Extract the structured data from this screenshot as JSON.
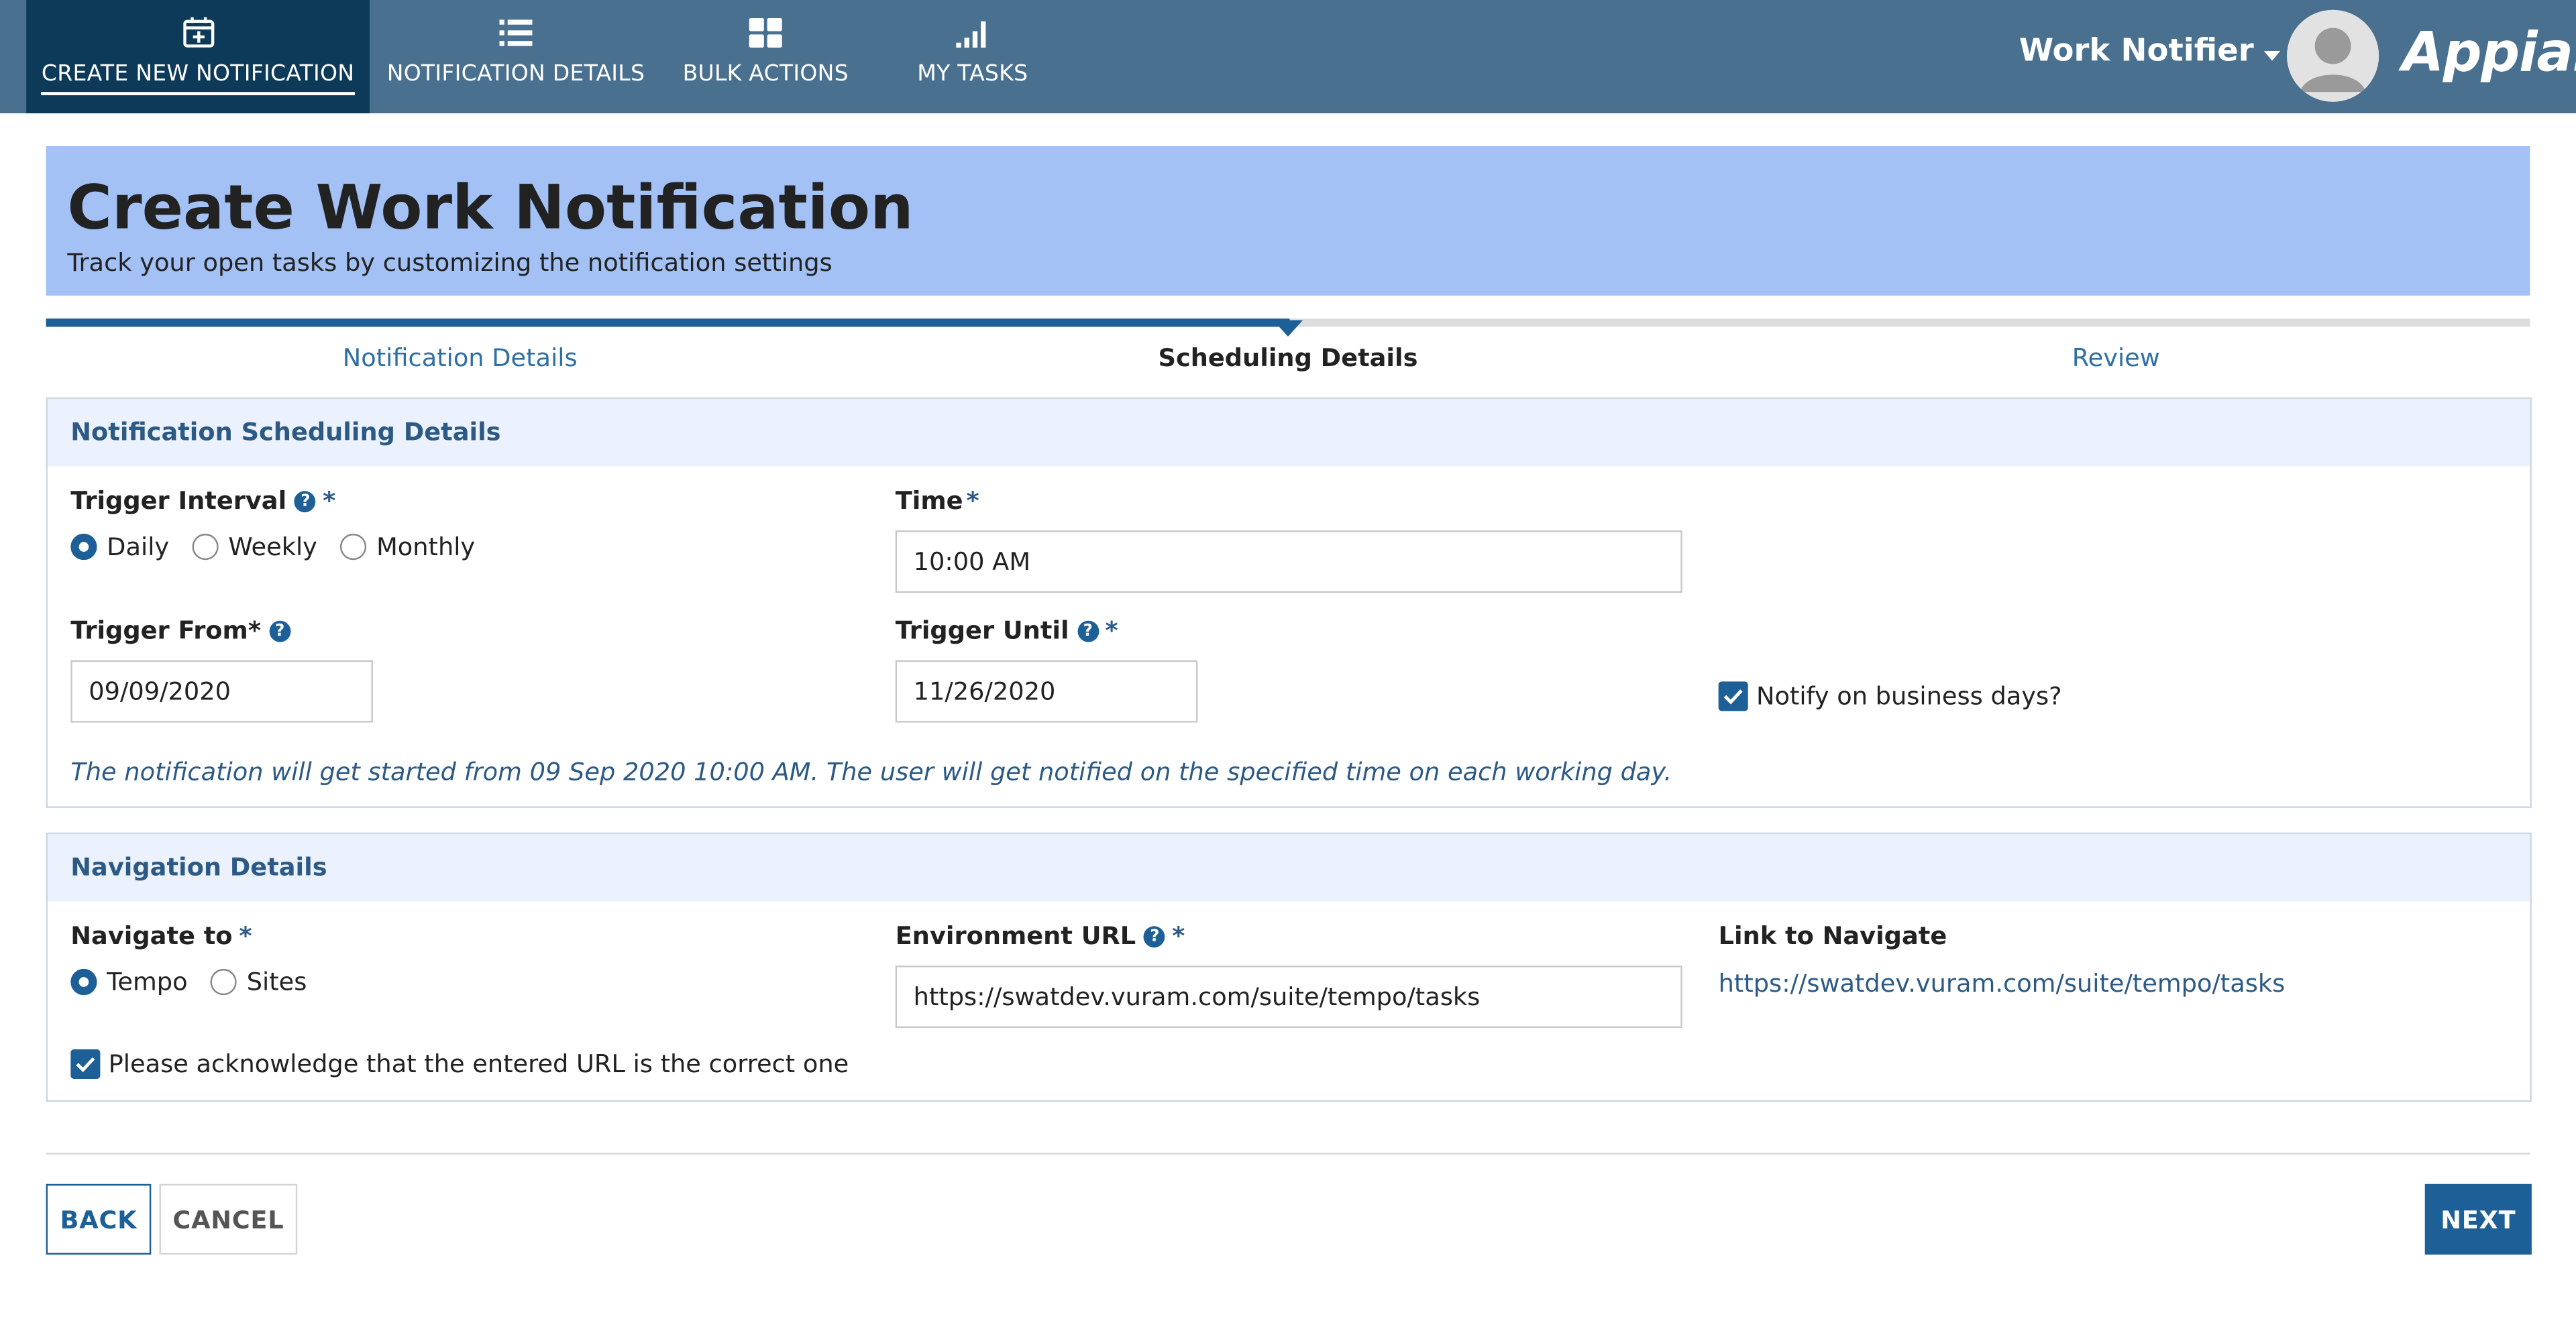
{
  "nav": {
    "tabs": [
      {
        "label": "CREATE NEW NOTIFICATION",
        "icon": "calendar-plus-icon",
        "active": true
      },
      {
        "label": "NOTIFICATION DETAILS",
        "icon": "list-icon",
        "active": false
      },
      {
        "label": "BULK ACTIONS",
        "icon": "grid-icon",
        "active": false
      },
      {
        "label": "MY TASKS",
        "icon": "signal-bars-icon",
        "active": false
      }
    ],
    "app_name": "Work Notifier",
    "logo": "Appian"
  },
  "header": {
    "title": "Create Work Notification",
    "subtitle": "Track your open tasks by customizing the notification settings"
  },
  "steps": {
    "items": [
      "Notification Details",
      "Scheduling Details",
      "Review"
    ],
    "current_index": 1
  },
  "scheduling": {
    "title": "Notification Scheduling Details",
    "trigger_interval_label": "Trigger Interval",
    "interval_options": [
      "Daily",
      "Weekly",
      "Monthly"
    ],
    "interval_selected": "Daily",
    "time_label": "Time",
    "time_value": "10:00 AM",
    "trigger_from_label": "Trigger From*",
    "trigger_from_value": "09/09/2020",
    "trigger_until_label": "Trigger Until",
    "trigger_until_value": "11/26/2020",
    "business_days_label": "Notify on business days?",
    "business_days_checked": true,
    "info_text": "The notification will get started from 09 Sep 2020 10:00 AM. The user will get notified on the specified time on each working day."
  },
  "navigation": {
    "title": "Navigation Details",
    "navigate_to_label": "Navigate to",
    "navigate_options": [
      "Tempo",
      "Sites"
    ],
    "navigate_selected": "Tempo",
    "env_url_label": "Environment URL",
    "env_url_value": "https://swatdev.vuram.com/suite/tempo/tasks",
    "link_label": "Link to Navigate",
    "link_value": "https://swatdev.vuram.com/suite/tempo/tasks",
    "acknowledge_label": "Please acknowledge that the entered URL is the correct one",
    "acknowledge_checked": true
  },
  "actions": {
    "back": "BACK",
    "cancel": "CANCEL",
    "next": "NEXT"
  },
  "colors": {
    "nav_bg": "#4a7090",
    "nav_active": "#0e3a5a",
    "header_band": "#a3c1f4",
    "accent": "#1d5f97",
    "section_head_bg": "#ebf2fd"
  }
}
